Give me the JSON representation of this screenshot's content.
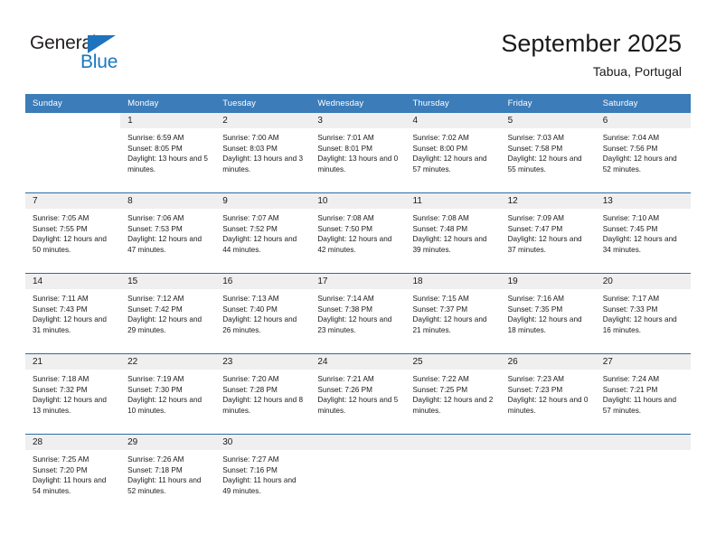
{
  "brand": {
    "name_part1": "General",
    "name_part2": "Blue",
    "triangle_icon": "triangle-icon",
    "accent_color": "#1879bf"
  },
  "header": {
    "title": "September 2025",
    "subtitle": "Tabua, Portugal"
  },
  "calendar": {
    "header_bg": "#3c7cb8",
    "daynum_bg": "#efefef",
    "separator_color": "#2e6ca4",
    "weekdays": [
      "Sunday",
      "Monday",
      "Tuesday",
      "Wednesday",
      "Thursday",
      "Friday",
      "Saturday"
    ],
    "weeks": [
      [
        {
          "day": "",
          "sunrise": "",
          "sunset": "",
          "daylight": "",
          "empty": true
        },
        {
          "day": "1",
          "sunrise": "Sunrise: 6:59 AM",
          "sunset": "Sunset: 8:05 PM",
          "daylight": "Daylight: 13 hours and 5 minutes."
        },
        {
          "day": "2",
          "sunrise": "Sunrise: 7:00 AM",
          "sunset": "Sunset: 8:03 PM",
          "daylight": "Daylight: 13 hours and 3 minutes."
        },
        {
          "day": "3",
          "sunrise": "Sunrise: 7:01 AM",
          "sunset": "Sunset: 8:01 PM",
          "daylight": "Daylight: 13 hours and 0 minutes."
        },
        {
          "day": "4",
          "sunrise": "Sunrise: 7:02 AM",
          "sunset": "Sunset: 8:00 PM",
          "daylight": "Daylight: 12 hours and 57 minutes."
        },
        {
          "day": "5",
          "sunrise": "Sunrise: 7:03 AM",
          "sunset": "Sunset: 7:58 PM",
          "daylight": "Daylight: 12 hours and 55 minutes."
        },
        {
          "day": "6",
          "sunrise": "Sunrise: 7:04 AM",
          "sunset": "Sunset: 7:56 PM",
          "daylight": "Daylight: 12 hours and 52 minutes."
        }
      ],
      [
        {
          "day": "7",
          "sunrise": "Sunrise: 7:05 AM",
          "sunset": "Sunset: 7:55 PM",
          "daylight": "Daylight: 12 hours and 50 minutes."
        },
        {
          "day": "8",
          "sunrise": "Sunrise: 7:06 AM",
          "sunset": "Sunset: 7:53 PM",
          "daylight": "Daylight: 12 hours and 47 minutes."
        },
        {
          "day": "9",
          "sunrise": "Sunrise: 7:07 AM",
          "sunset": "Sunset: 7:52 PM",
          "daylight": "Daylight: 12 hours and 44 minutes."
        },
        {
          "day": "10",
          "sunrise": "Sunrise: 7:08 AM",
          "sunset": "Sunset: 7:50 PM",
          "daylight": "Daylight: 12 hours and 42 minutes."
        },
        {
          "day": "11",
          "sunrise": "Sunrise: 7:08 AM",
          "sunset": "Sunset: 7:48 PM",
          "daylight": "Daylight: 12 hours and 39 minutes."
        },
        {
          "day": "12",
          "sunrise": "Sunrise: 7:09 AM",
          "sunset": "Sunset: 7:47 PM",
          "daylight": "Daylight: 12 hours and 37 minutes."
        },
        {
          "day": "13",
          "sunrise": "Sunrise: 7:10 AM",
          "sunset": "Sunset: 7:45 PM",
          "daylight": "Daylight: 12 hours and 34 minutes."
        }
      ],
      [
        {
          "day": "14",
          "sunrise": "Sunrise: 7:11 AM",
          "sunset": "Sunset: 7:43 PM",
          "daylight": "Daylight: 12 hours and 31 minutes."
        },
        {
          "day": "15",
          "sunrise": "Sunrise: 7:12 AM",
          "sunset": "Sunset: 7:42 PM",
          "daylight": "Daylight: 12 hours and 29 minutes."
        },
        {
          "day": "16",
          "sunrise": "Sunrise: 7:13 AM",
          "sunset": "Sunset: 7:40 PM",
          "daylight": "Daylight: 12 hours and 26 minutes."
        },
        {
          "day": "17",
          "sunrise": "Sunrise: 7:14 AM",
          "sunset": "Sunset: 7:38 PM",
          "daylight": "Daylight: 12 hours and 23 minutes."
        },
        {
          "day": "18",
          "sunrise": "Sunrise: 7:15 AM",
          "sunset": "Sunset: 7:37 PM",
          "daylight": "Daylight: 12 hours and 21 minutes."
        },
        {
          "day": "19",
          "sunrise": "Sunrise: 7:16 AM",
          "sunset": "Sunset: 7:35 PM",
          "daylight": "Daylight: 12 hours and 18 minutes."
        },
        {
          "day": "20",
          "sunrise": "Sunrise: 7:17 AM",
          "sunset": "Sunset: 7:33 PM",
          "daylight": "Daylight: 12 hours and 16 minutes."
        }
      ],
      [
        {
          "day": "21",
          "sunrise": "Sunrise: 7:18 AM",
          "sunset": "Sunset: 7:32 PM",
          "daylight": "Daylight: 12 hours and 13 minutes."
        },
        {
          "day": "22",
          "sunrise": "Sunrise: 7:19 AM",
          "sunset": "Sunset: 7:30 PM",
          "daylight": "Daylight: 12 hours and 10 minutes."
        },
        {
          "day": "23",
          "sunrise": "Sunrise: 7:20 AM",
          "sunset": "Sunset: 7:28 PM",
          "daylight": "Daylight: 12 hours and 8 minutes."
        },
        {
          "day": "24",
          "sunrise": "Sunrise: 7:21 AM",
          "sunset": "Sunset: 7:26 PM",
          "daylight": "Daylight: 12 hours and 5 minutes."
        },
        {
          "day": "25",
          "sunrise": "Sunrise: 7:22 AM",
          "sunset": "Sunset: 7:25 PM",
          "daylight": "Daylight: 12 hours and 2 minutes."
        },
        {
          "day": "26",
          "sunrise": "Sunrise: 7:23 AM",
          "sunset": "Sunset: 7:23 PM",
          "daylight": "Daylight: 12 hours and 0 minutes."
        },
        {
          "day": "27",
          "sunrise": "Sunrise: 7:24 AM",
          "sunset": "Sunset: 7:21 PM",
          "daylight": "Daylight: 11 hours and 57 minutes."
        }
      ],
      [
        {
          "day": "28",
          "sunrise": "Sunrise: 7:25 AM",
          "sunset": "Sunset: 7:20 PM",
          "daylight": "Daylight: 11 hours and 54 minutes."
        },
        {
          "day": "29",
          "sunrise": "Sunrise: 7:26 AM",
          "sunset": "Sunset: 7:18 PM",
          "daylight": "Daylight: 11 hours and 52 minutes."
        },
        {
          "day": "30",
          "sunrise": "Sunrise: 7:27 AM",
          "sunset": "Sunset: 7:16 PM",
          "daylight": "Daylight: 11 hours and 49 minutes."
        },
        {
          "day": "",
          "sunrise": "",
          "sunset": "",
          "daylight": "",
          "empty": true
        },
        {
          "day": "",
          "sunrise": "",
          "sunset": "",
          "daylight": "",
          "empty": true
        },
        {
          "day": "",
          "sunrise": "",
          "sunset": "",
          "daylight": "",
          "empty": true
        },
        {
          "day": "",
          "sunrise": "",
          "sunset": "",
          "daylight": "",
          "empty": true
        }
      ]
    ]
  }
}
